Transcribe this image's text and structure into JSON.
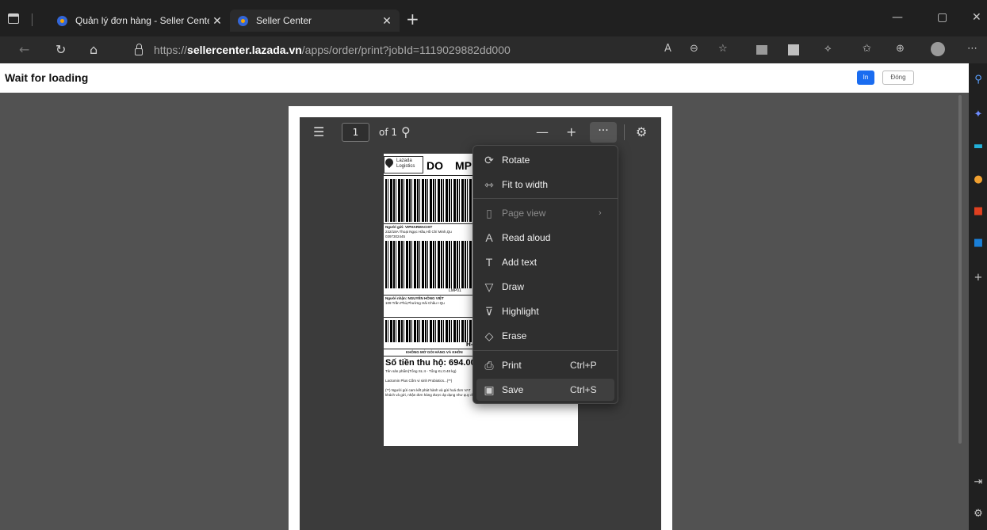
{
  "browser": {
    "tabs": [
      {
        "title": "Quản lý đơn hàng - Seller Center",
        "close": "✕"
      },
      {
        "title": "Seller Center",
        "close": "✕"
      }
    ],
    "new_tab": "+",
    "window_controls": {
      "minimize": "—",
      "restore": "▢",
      "close": "✕"
    },
    "url_prefix": "https://",
    "url_host": "sellercenter.lazada.vn",
    "url_path": "/apps/order/print?jobId=1119029882dd000",
    "nav": {
      "back": "←",
      "refresh": "↻",
      "home": "⌂"
    },
    "toolbar_icons": {
      "read_aloud": "A",
      "zoom": "⊖",
      "favorite": "☆",
      "more": "⋯"
    }
  },
  "page": {
    "title": "Wait for loading",
    "print_button": "In",
    "close_button": "Đóng"
  },
  "pdf_toolbar": {
    "page_current": "1",
    "page_total": "of 1",
    "zoom_out": "—",
    "zoom_in": "+",
    "more": "···"
  },
  "label": {
    "brand_line1": "Lazada",
    "brand_line2": "Logistics",
    "code_do": "DO",
    "code_mp": "MP",
    "sender_label": "Người gửi: VIPHARMACIST",
    "sender_address": "232/18A Thoại Ngọc Hầu,Hồ Chí Minh,Qu",
    "sender_phone": "0397302445",
    "tracking_suffix": "LMP01",
    "receiver_label": "Người nhận: NGUYỄN HỒNG VIỆT",
    "receiver_address": "109 Trần Phú,Phường Hải Châu I-Qu",
    "h_suffix": "H-",
    "warning": "KHÔNG MỞ GÓI HÀNG VÀ KHÔN",
    "cod": "Số tiền thu hộ: 694.000",
    "product_line": "Tên sản phẩm(Tổng SL:4 - Tổng KL:0.48 kg)",
    "product_name": "Lactomin Plus Cốm vi sinh Probiotics...(**)",
    "note1": "(**) Người gửi cam kết phát hành và gửi hoá đơn VAT",
    "note2": "khách và gửi, nhận đơn hàng được áp dụng như quy định"
  },
  "menu": {
    "items": [
      {
        "label": "Rotate",
        "shortcut": "",
        "icon": "rotate-icon",
        "glyph": "⟳"
      },
      {
        "label": "Fit to width",
        "shortcut": "",
        "icon": "fit-width-icon",
        "glyph": "⇿"
      },
      {
        "label": "Page view",
        "shortcut": "",
        "icon": "page-view-icon",
        "glyph": "▯",
        "disabled": true,
        "submenu": "›"
      },
      {
        "label": "Read aloud",
        "shortcut": "",
        "icon": "read-aloud-icon",
        "glyph": "A"
      },
      {
        "label": "Add text",
        "shortcut": "",
        "icon": "add-text-icon",
        "glyph": "T"
      },
      {
        "label": "Draw",
        "shortcut": "",
        "icon": "draw-icon",
        "glyph": "▽"
      },
      {
        "label": "Highlight",
        "shortcut": "",
        "icon": "highlight-icon",
        "glyph": "⊽"
      },
      {
        "label": "Erase",
        "shortcut": "",
        "icon": "erase-icon",
        "glyph": "◇"
      },
      {
        "label": "Print",
        "shortcut": "Ctrl+P",
        "icon": "print-icon",
        "glyph": "⎙"
      },
      {
        "label": "Save",
        "shortcut": "Ctrl+S",
        "icon": "save-icon",
        "glyph": "▣"
      }
    ]
  },
  "colors": {
    "accent_blue": "#1a6cf0",
    "menu_bg": "#2f2f2f",
    "viewer_bg": "#525252"
  }
}
